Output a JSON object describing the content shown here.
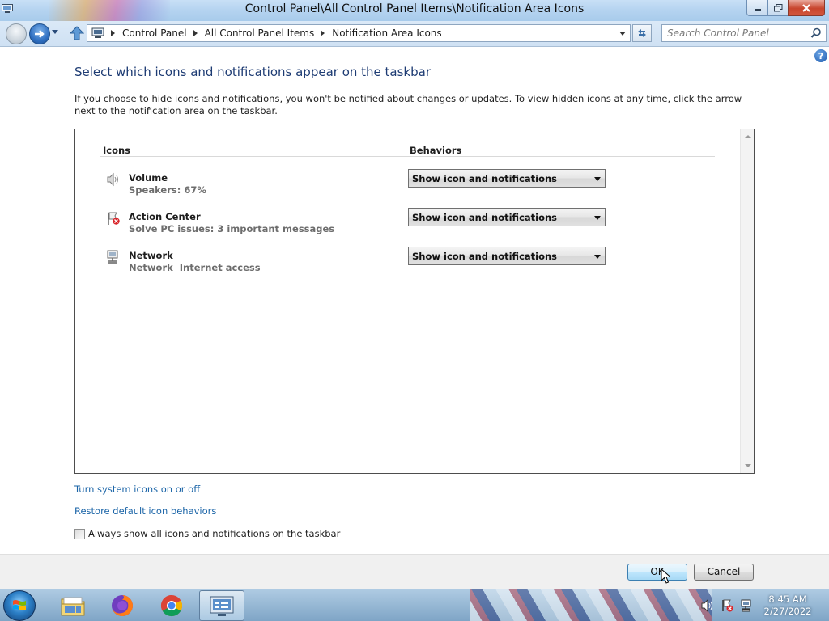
{
  "window": {
    "title": "Control Panel\\All Control Panel Items\\Notification Area Icons"
  },
  "address_bar": {
    "crumbs": [
      "Control Panel",
      "All Control Panel Items",
      "Notification Area Icons"
    ],
    "search_placeholder": "Search Control Panel"
  },
  "content": {
    "heading": "Select which icons and notifications appear on the taskbar",
    "intro": "If you choose to hide icons and notifications, you won't be notified about changes or updates. To view hidden icons at any time, click the arrow next to the notification area on the taskbar.",
    "columns": {
      "icons": "Icons",
      "behaviors": "Behaviors"
    },
    "rows": [
      {
        "name": "Volume",
        "desc": "Speakers: 67%",
        "icon": "speaker-icon",
        "behavior": "Show icon and notifications"
      },
      {
        "name": "Action Center",
        "desc": "Solve PC issues: 3 important messages",
        "icon": "action-center-flag-icon",
        "behavior": "Show icon and notifications"
      },
      {
        "name": "Network",
        "desc": "Network  Internet access",
        "icon": "network-icon",
        "behavior": "Show icon and notifications"
      }
    ],
    "links": {
      "system_icons": "Turn system icons on or off",
      "restore": "Restore default icon behaviors"
    },
    "always_show": {
      "label": "Always show all icons and notifications on the taskbar",
      "checked": false
    }
  },
  "footer": {
    "ok": "OK",
    "cancel": "Cancel"
  },
  "taskbar": {
    "pinned": [
      "file-explorer-icon",
      "firefox-icon",
      "chrome-icon",
      "control-panel-icon"
    ],
    "tray_icons": [
      "speaker-icon",
      "action-center-flag-icon",
      "network-icon"
    ],
    "time": "8:45 AM",
    "date": "2/27/2022"
  },
  "colors": {
    "heading": "#1d3b73",
    "link": "#1a64a7",
    "ok_border": "#3c7fb1"
  }
}
